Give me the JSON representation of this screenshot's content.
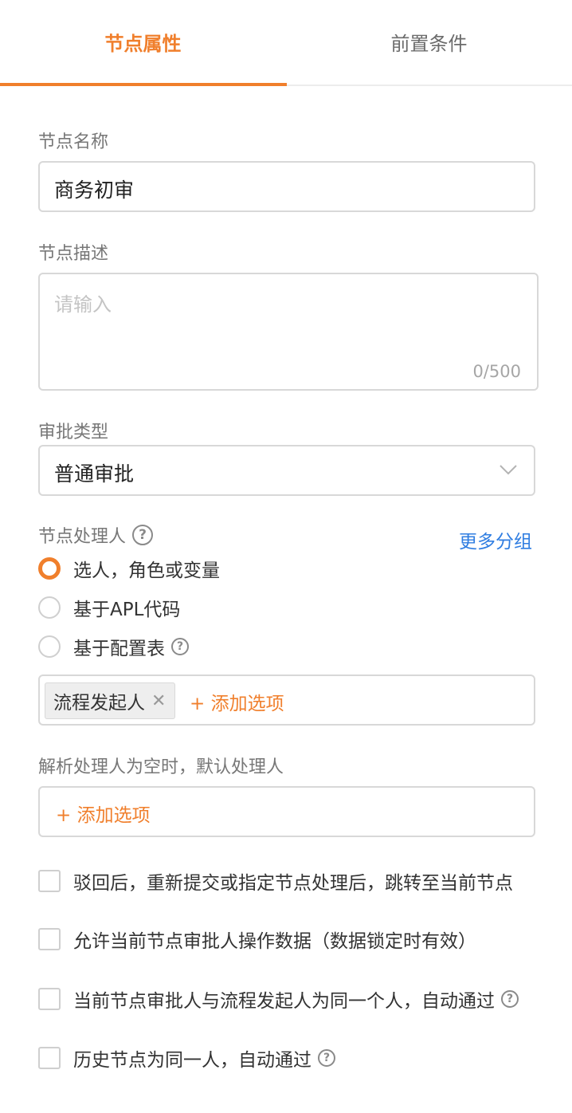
{
  "tabs": [
    {
      "label": "节点属性",
      "active": true
    },
    {
      "label": "前置条件",
      "active": false
    }
  ],
  "node_name": {
    "label": "节点名称",
    "value": "商务初审"
  },
  "node_desc": {
    "label": "节点描述",
    "placeholder": "请输入",
    "counter": "0/500"
  },
  "approval_type": {
    "label": "审批类型",
    "value": "普通审批"
  },
  "handler": {
    "label": "节点处理人",
    "help_icon": "question-circle-icon",
    "more_group": "更多分组",
    "options": [
      {
        "label": "选人，角色或变量",
        "checked": true
      },
      {
        "label": "基于APL代码",
        "checked": false
      },
      {
        "label": "基于配置表",
        "checked": false,
        "has_help": true
      }
    ],
    "tags": [
      {
        "label": "流程发起人",
        "close_icon": "close-icon"
      }
    ],
    "add_option": "+ 添加选项"
  },
  "default_handler": {
    "label": "解析处理人为空时，默认处理人",
    "add_option": "+ 添加选项"
  },
  "checkboxes": [
    {
      "label": "驳回后，重新提交或指定节点处理后，跳转至当前节点",
      "checked": false
    },
    {
      "label": "允许当前节点审批人操作数据（数据锁定时有效）",
      "checked": false
    },
    {
      "label": "当前节点审批人与流程发起人为同一个人，自动通过",
      "checked": false,
      "has_help": true
    },
    {
      "label": "历史节点为同一人，自动通过",
      "checked": false,
      "has_help": true
    }
  ],
  "colors": {
    "accent": "#f07f2c",
    "link": "#2f7de1",
    "border": "#d8d8d8"
  }
}
